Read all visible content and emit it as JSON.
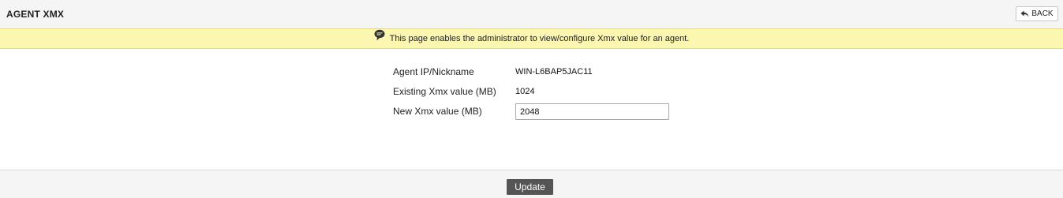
{
  "header": {
    "title": "AGENT XMX",
    "back_label": "BACK"
  },
  "info": {
    "message": "This page enables the administrator to view/configure Xmx value for an agent."
  },
  "form": {
    "agent_label": "Agent IP/Nickname",
    "agent_value": "WIN-L6BAP5JAC11",
    "existing_label": "Existing Xmx value (MB)",
    "existing_value": "1024",
    "new_label": "New Xmx value (MB)",
    "new_value": "2048"
  },
  "footer": {
    "update_label": "Update"
  },
  "colors": {
    "info_bar": "#fbf6b0",
    "button": "#555555",
    "header_bg": "#f5f5f5"
  }
}
